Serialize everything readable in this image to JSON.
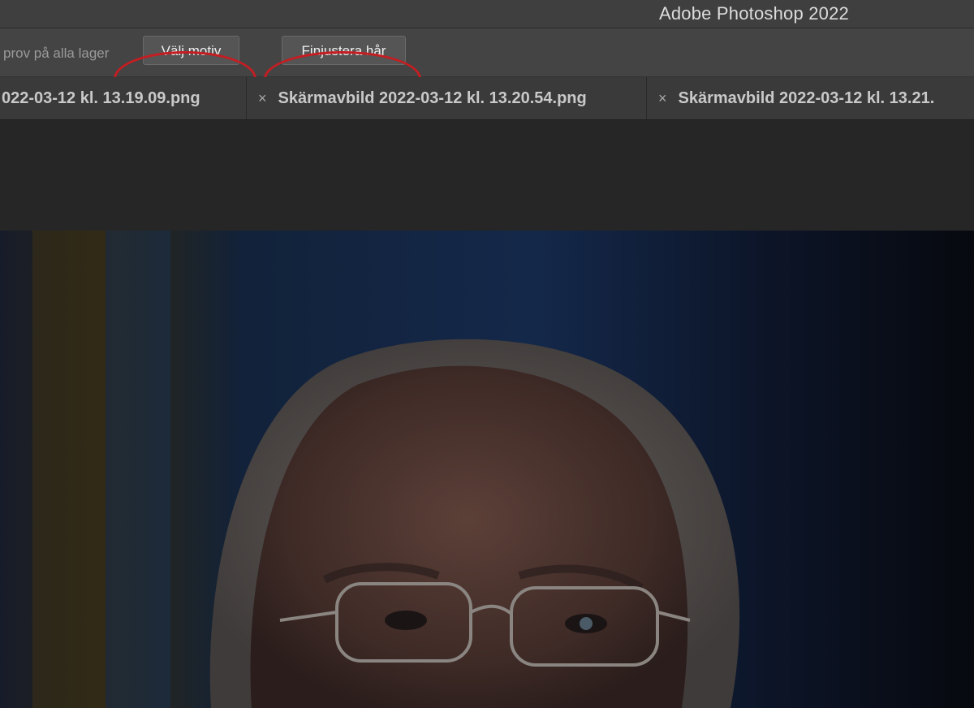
{
  "window": {
    "title": "Adobe Photoshop 2022"
  },
  "options_bar": {
    "sample_all_layers_label": "prov på alla lager",
    "select_subject_label": "Välj motiv",
    "refine_hair_label": "Finjustera hår"
  },
  "tabs": [
    {
      "label": "022-03-12 kl. 13.19.09.png",
      "close": ""
    },
    {
      "label": "Skärmavbild 2022-03-12 kl. 13.20.54.png",
      "close": "×"
    },
    {
      "label": "Skärmavbild 2022-03-12 kl. 13.21.",
      "close": "×"
    }
  ],
  "colors": {
    "annotation": "#c51d22",
    "titlebar": "#3f3f3f",
    "options_bar": "#444444",
    "tab_bar": "#3a3a3a"
  },
  "icons": {
    "cursor": "arrow-cursor-icon",
    "close": "close-icon"
  }
}
